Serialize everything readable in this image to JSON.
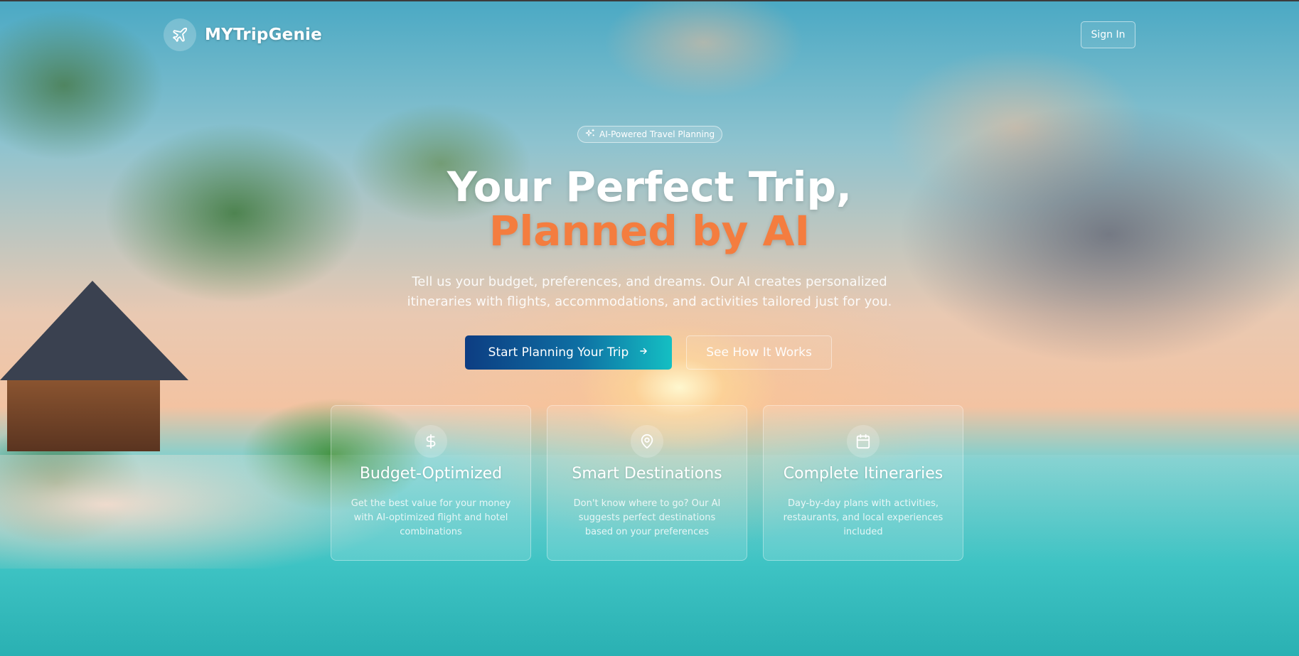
{
  "brand": {
    "name": "MYTripGenie",
    "logo_icon": "airplane-icon"
  },
  "nav": {
    "signin_label": "Sign In"
  },
  "hero": {
    "badge": {
      "icon": "sparkles-icon",
      "label": "AI-Powered Travel Planning"
    },
    "title_line1": "Your Perfect Trip,",
    "title_line2": "Planned by AI",
    "subtitle": "Tell us your budget, preferences, and dreams. Our AI creates personalized itineraries with flights, accommodations, and activities tailored just for you.",
    "cta_primary": "Start Planning Your Trip",
    "cta_primary_icon": "arrow-right-icon",
    "cta_secondary": "See How It Works"
  },
  "features": [
    {
      "icon": "dollar-icon",
      "title": "Budget-Optimized",
      "description": "Get the best value for your money with AI-optimized flight and hotel combinations"
    },
    {
      "icon": "map-pin-icon",
      "title": "Smart Destinations",
      "description": "Don't know where to go? Our AI suggests perfect destinations based on your preferences"
    },
    {
      "icon": "calendar-icon",
      "title": "Complete Itineraries",
      "description": "Day-by-day plans with activities, restaurants, and local experiences included"
    }
  ],
  "colors": {
    "accent": "#f47d3f",
    "cta_start": "#0d3d82",
    "cta_end": "#14bfc3"
  }
}
